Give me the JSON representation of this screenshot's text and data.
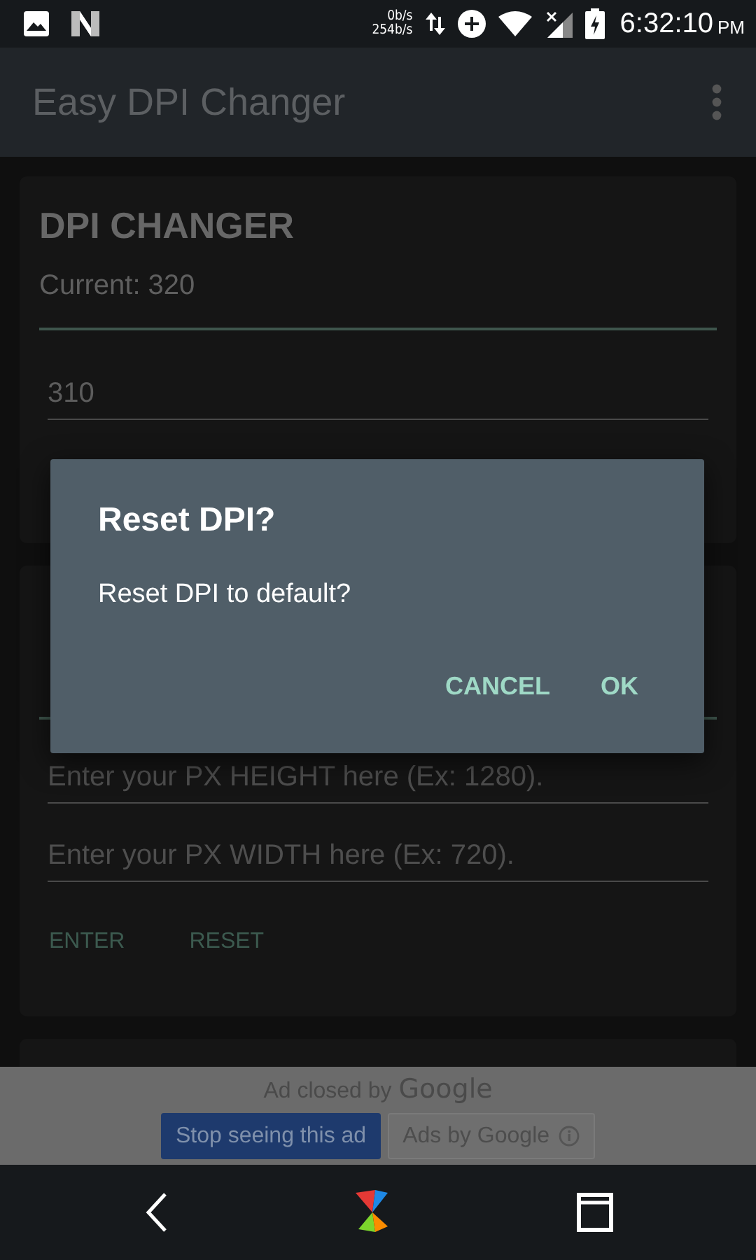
{
  "status_bar": {
    "net_down": "0b/s",
    "net_up": "254b/s",
    "time": "6:32:10",
    "ampm": "PM"
  },
  "app_bar": {
    "title": "Easy DPI Changer"
  },
  "cards": [
    {
      "title": "DPI CHANGER",
      "current": "Current: 320",
      "field": {
        "value": "310"
      }
    },
    {
      "fields": [
        {
          "placeholder": "Enter your PX HEIGHT here (Ex: 1280)."
        },
        {
          "placeholder": "Enter your PX WIDTH here (Ex: 720)."
        }
      ],
      "buttons": [
        "ENTER",
        "RESET"
      ]
    }
  ],
  "dialog": {
    "title": "Reset DPI?",
    "message": "Reset DPI to default?",
    "buttons": [
      "CANCEL",
      "OK"
    ]
  },
  "ad": {
    "label": "Ad closed by",
    "brand": "Google",
    "stop_button": "Stop seeing this ad",
    "ads_by": "Ads by Google"
  }
}
